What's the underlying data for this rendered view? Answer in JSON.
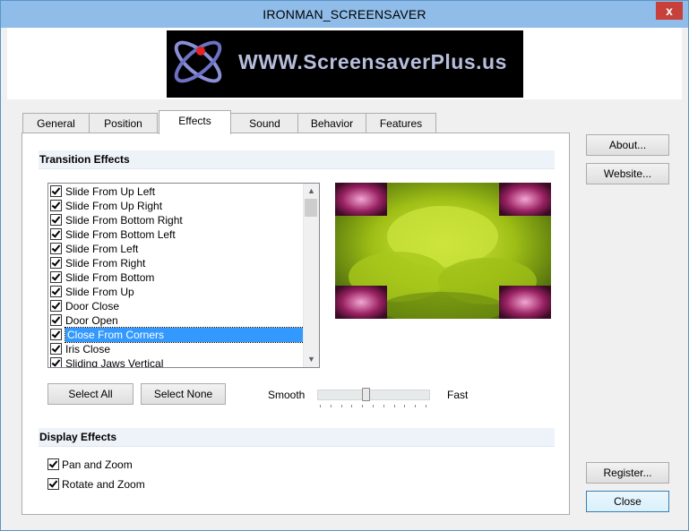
{
  "window": {
    "title": "IRONMAN_SCREENSAVER",
    "close_glyph": "x"
  },
  "banner": {
    "text": "WWW.ScreensaverPlus.us"
  },
  "tabs": [
    {
      "label": "General"
    },
    {
      "label": "Position"
    },
    {
      "label": "Effects",
      "active": true
    },
    {
      "label": "Sound"
    },
    {
      "label": "Behavior"
    },
    {
      "label": "Features"
    }
  ],
  "transition": {
    "header": "Transition Effects",
    "items": [
      {
        "label": "Slide From Up Left",
        "checked": true
      },
      {
        "label": "Slide From Up Right",
        "checked": true
      },
      {
        "label": "Slide From Bottom Right",
        "checked": true
      },
      {
        "label": "Slide From Bottom Left",
        "checked": true
      },
      {
        "label": "Slide From Left",
        "checked": true
      },
      {
        "label": "Slide From Right",
        "checked": true
      },
      {
        "label": "Slide From Bottom",
        "checked": true
      },
      {
        "label": "Slide From Up",
        "checked": true
      },
      {
        "label": "Door Close",
        "checked": true
      },
      {
        "label": "Door Open",
        "checked": true
      },
      {
        "label": "Close From Corners",
        "checked": true,
        "selected": true
      },
      {
        "label": "Iris Close",
        "checked": true
      },
      {
        "label": "Sliding Jaws Vertical",
        "checked": true
      }
    ],
    "select_all": "Select All",
    "select_none": "Select None",
    "smooth_label": "Smooth",
    "fast_label": "Fast",
    "speed_fraction": 0.43
  },
  "display": {
    "header": "Display Effects",
    "pan_zoom": "Pan and Zoom",
    "rotate_zoom": "Rotate and Zoom"
  },
  "side_buttons": {
    "about": "About...",
    "website": "Website...",
    "register": "Register...",
    "close": "Close"
  },
  "icons": [
    "atom-logo-icon",
    "check-icon",
    "scroll-up-arrow-icon",
    "scroll-down-arrow-icon"
  ]
}
